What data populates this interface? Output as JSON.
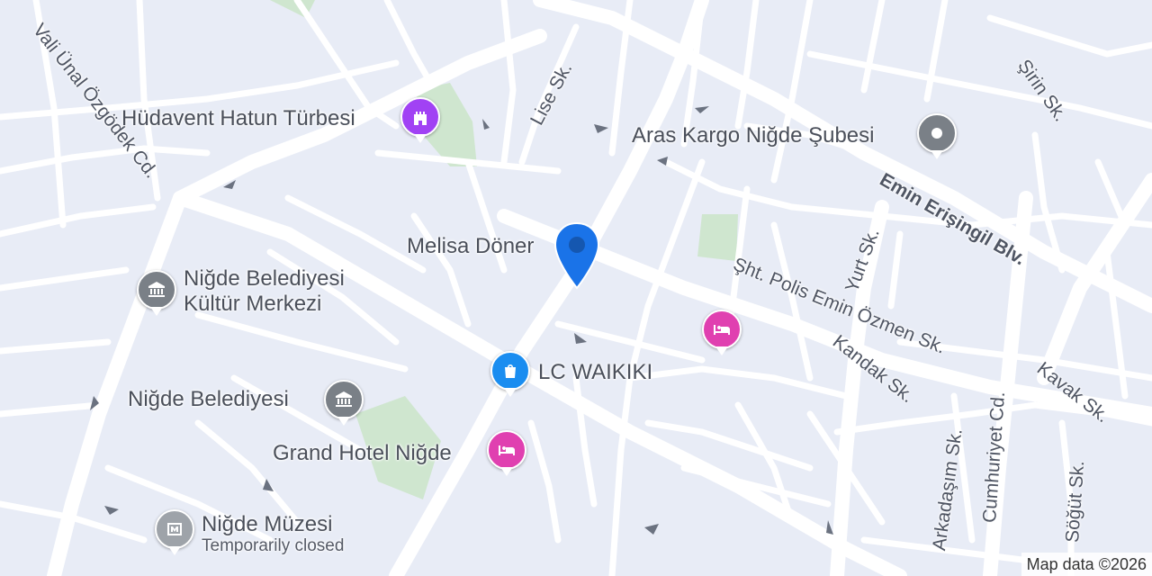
{
  "map": {
    "attribution": "Map data ©2026",
    "colors": {
      "land": "#e8ecf6",
      "road": "#ffffff",
      "park": "#cfe6cf",
      "pin_blue": "#1a73e8",
      "poi_purple": "#a142f4",
      "poi_gray": "#7a8087",
      "poi_pink": "#e040b0",
      "poi_shopping": "#1a8df0"
    }
  },
  "pois": {
    "hudavent": {
      "name": "Hüdavent Hatun Türbesi",
      "icon": "castle-icon"
    },
    "aras": {
      "name": "Aras Kargo Niğde Şubesi",
      "icon": "location-dot-icon"
    },
    "melisa": {
      "name": "Melisa Döner"
    },
    "kultur": {
      "name_line1": "Niğde Belediyesi",
      "name_line2": "Kültür Merkezi",
      "icon": "museum-icon"
    },
    "belediye": {
      "name": "Niğde Belediyesi",
      "icon": "museum-icon"
    },
    "lcw": {
      "name": "LC WAIKIKI",
      "icon": "shopping-bag-icon"
    },
    "grand_hotel": {
      "name": "Grand Hotel Niğde",
      "icon": "bed-icon"
    },
    "hotel2": {
      "icon": "bed-icon"
    },
    "muze": {
      "name": "Niğde Müzesi",
      "status": "Temporarily closed",
      "icon": "museum-icon"
    }
  },
  "streets": {
    "vali_unal": "Vali Ünal Özgödek Cd.",
    "lise": "Lise Sk.",
    "sirin": "Şirin Sk.",
    "emin": "Emin Erişingil Blv.",
    "yurt": "Yurt Sk.",
    "sht_polis": "Şht. Polis Emin Özmen Sk.",
    "kandak": "Kandak Sk.",
    "kavak": "Kavak Sk.",
    "arkadasim": "Arkadaşım Sk.",
    "cumhuriyet": "Cumhuriyet Cd.",
    "sogut": "Söğüt Sk."
  }
}
